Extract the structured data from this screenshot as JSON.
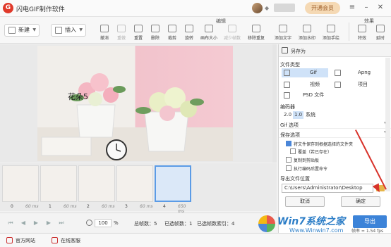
{
  "app": {
    "title": "闪电GIF制作软件",
    "logo": "G",
    "vip_button": "开通会员"
  },
  "toolbar": {
    "new_label": "新建",
    "insert_label": "插入",
    "groups": {
      "edit": "编辑",
      "effects": "效果"
    },
    "tools": [
      {
        "label": "撤消",
        "disabled": false
      },
      {
        "label": "重做",
        "disabled": true
      },
      {
        "label": "重置",
        "disabled": false
      },
      {
        "label": "删除",
        "disabled": false
      },
      {
        "label": "裁剪",
        "disabled": false
      },
      {
        "label": "旋转",
        "disabled": false
      },
      {
        "label": "画布大小",
        "disabled": false
      },
      {
        "label": "减少帧数",
        "disabled": true
      },
      {
        "label": "移除重复",
        "disabled": false
      },
      {
        "label": "添加文字",
        "disabled": false
      },
      {
        "label": "添加水印",
        "disabled": false
      },
      {
        "label": "添加手绘",
        "disabled": false
      },
      {
        "label": "特效",
        "disabled": false
      },
      {
        "label": "延时",
        "disabled": false
      }
    ]
  },
  "canvas": {
    "caption": "花朵5"
  },
  "filmstrip": {
    "frames": [
      {
        "index": "0",
        "delay": "60 ms",
        "selected": false
      },
      {
        "index": "1",
        "delay": "60 ms",
        "selected": false
      },
      {
        "index": "2",
        "delay": "60 ms",
        "selected": false
      },
      {
        "index": "3",
        "delay": "60 ms",
        "selected": false
      },
      {
        "index": "4",
        "delay": "650 ms",
        "selected": true
      }
    ]
  },
  "bottombar": {
    "zoom_value": "100",
    "zoom_unit": "%",
    "total_frames": "总帧数：5",
    "selected_frames": "已选帧数：1",
    "selected_index": "已选帧数索引：4"
  },
  "footer": {
    "website": "官方网站",
    "support": "在线客服"
  },
  "save_panel": {
    "title": "另存为",
    "file_type_label": "文件类型",
    "formats": [
      {
        "label": "Gif",
        "selected": true
      },
      {
        "label": "Apng",
        "selected": false
      },
      {
        "label": "视频",
        "selected": false
      },
      {
        "label": "项目",
        "selected": false
      },
      {
        "label": "PSD 文件",
        "selected": false
      }
    ],
    "encoder_label": "编码器",
    "speeds": [
      "2.0",
      "1.0",
      "系统"
    ],
    "gif_options_label": "Gif 选项",
    "extra_label": "",
    "save_options_label": "保存选项",
    "options": [
      {
        "label": "将文件保存到根据选择的文件夹",
        "checked": true,
        "disabled": false
      },
      {
        "label": "覆盖（若已存在）",
        "checked": false,
        "disabled": false
      },
      {
        "label": "复制到剪贴板",
        "checked": false,
        "disabled": false
      },
      {
        "label": "执行编码后置命令",
        "checked": false,
        "disabled": false
      }
    ],
    "export_location_label": "导出文件位置",
    "path_value": "C:\\Users\\Administrator\\Desktop",
    "cancel_label": "取消",
    "ok_label": "确定",
    "export_label": "导出"
  },
  "watermark": {
    "text": "Win7系统之家",
    "url": "Www.Winwin7.com"
  },
  "status": {
    "fps": "帧率 = 1.54 fps"
  }
}
